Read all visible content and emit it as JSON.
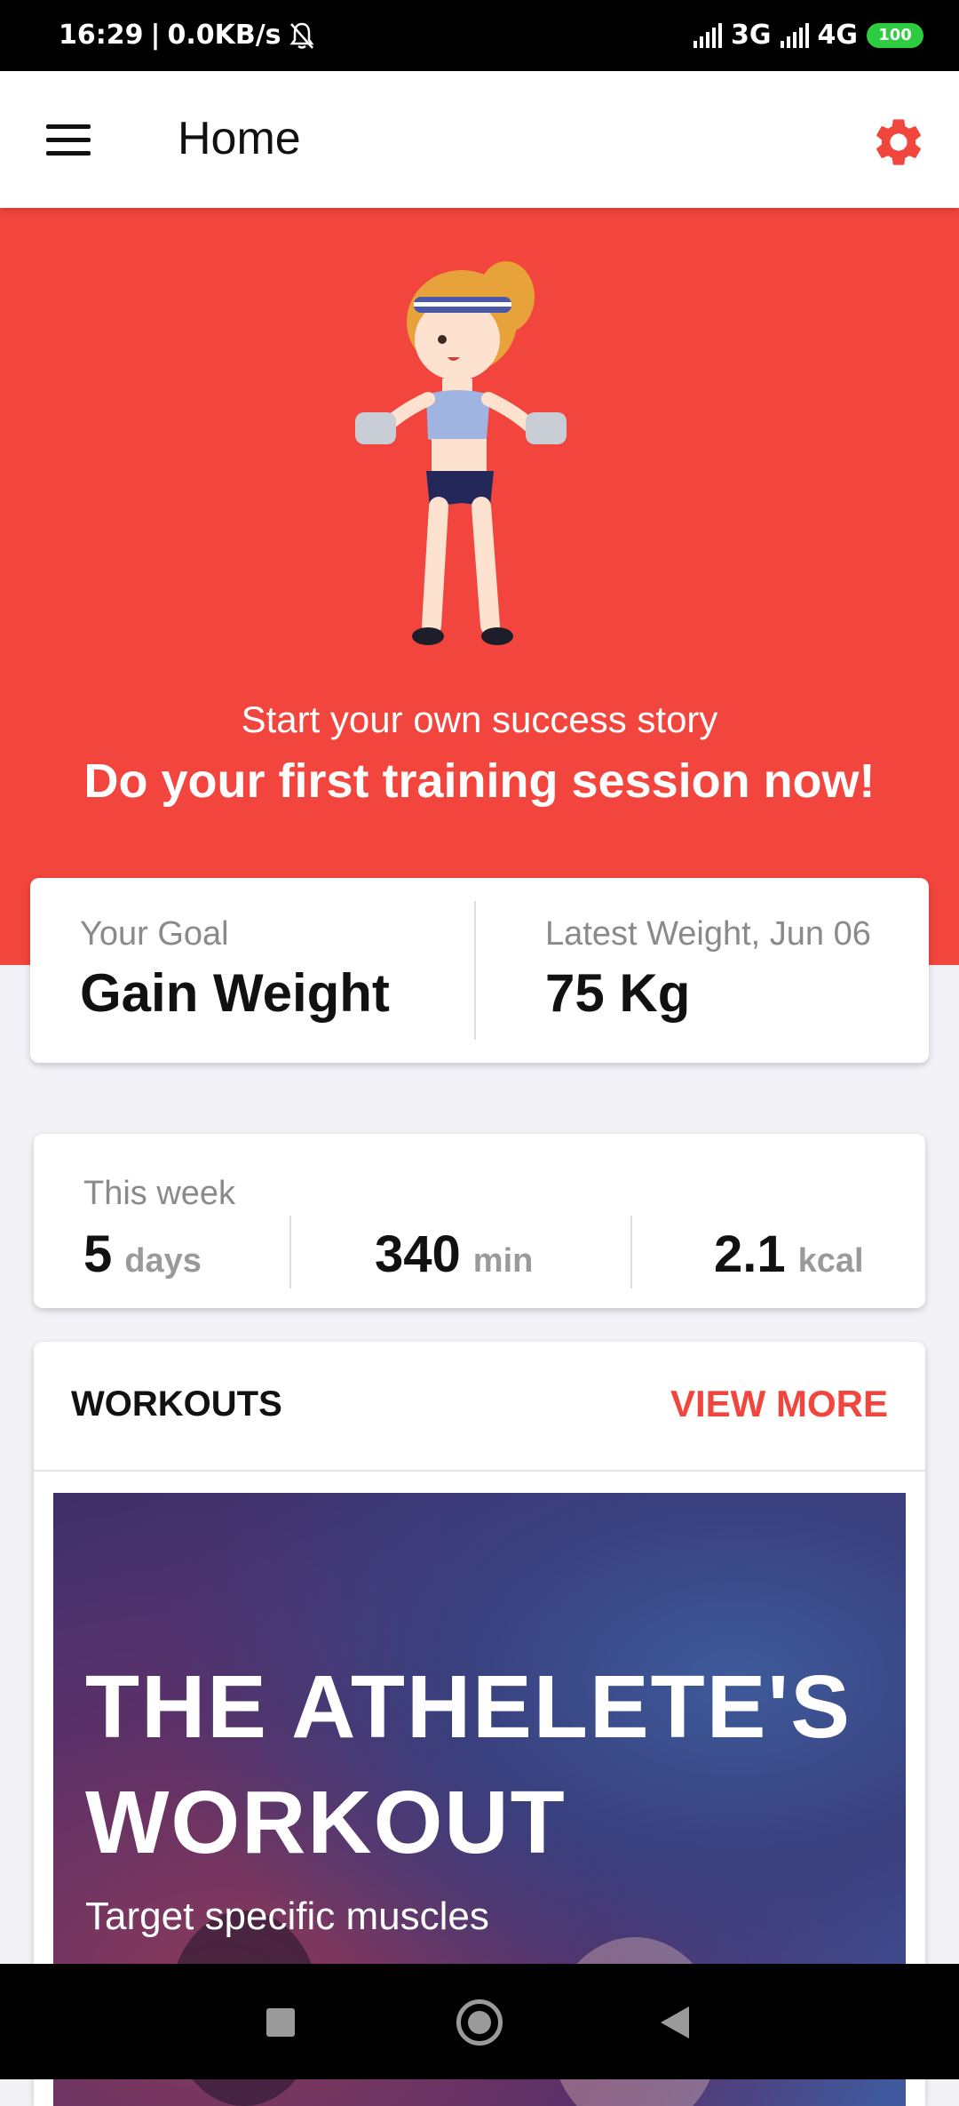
{
  "status_bar": {
    "time": "16:29",
    "speed": "0.0KB/s",
    "network1": "3G",
    "network2": "4G",
    "battery": "100"
  },
  "app_bar": {
    "title": "Home",
    "menu_icon": "hamburger-menu-icon",
    "settings_icon": "gear-icon"
  },
  "hero": {
    "subtitle": "Start your own success story",
    "title": "Do your first training session now!"
  },
  "goal_card": {
    "goal_label": "Your Goal",
    "goal_value": "Gain Weight",
    "weight_label": "Latest Weight, Jun 06",
    "weight_value": "75 Kg"
  },
  "week_card": {
    "label": "This week",
    "days_value": "5",
    "days_unit": "days",
    "minutes_value": "340",
    "minutes_unit": "min",
    "kcal_value": "2.1",
    "kcal_unit": "kcal"
  },
  "workouts": {
    "title": "WORKOUTS",
    "view_more": "VIEW MORE",
    "banner_title_line1": "THE ATHELETE'S",
    "banner_title_line2": "WORKOUT",
    "banner_subtitle": "Target specific muscles"
  },
  "colors": {
    "accent": "#f2453d",
    "background": "#f2f2f7"
  }
}
